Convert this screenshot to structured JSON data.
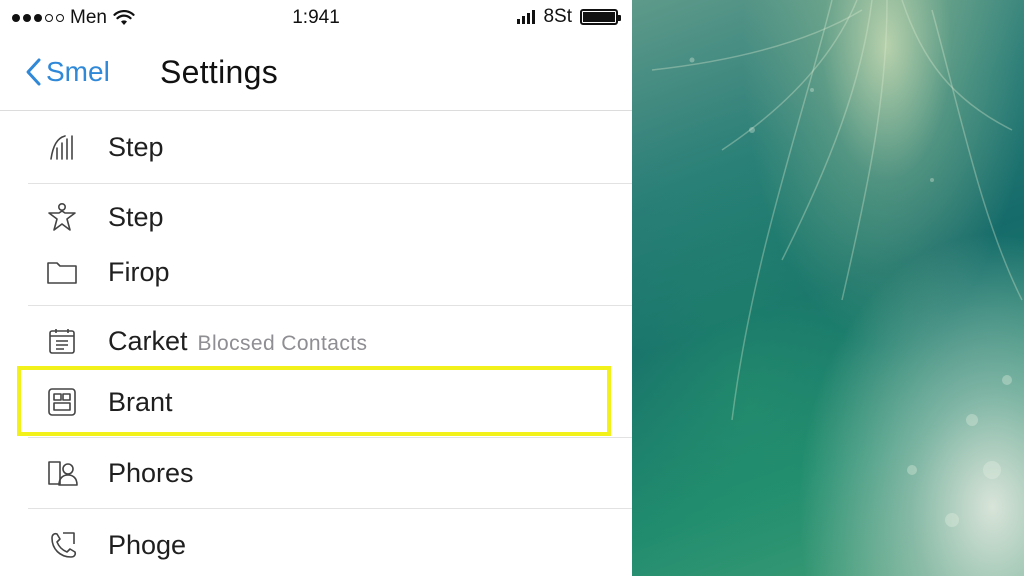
{
  "status_bar": {
    "carrier": "Men",
    "time": "1:941",
    "network": "8St"
  },
  "nav": {
    "back_label": "Smel",
    "title": "Settings"
  },
  "rows": [
    {
      "label": "Step",
      "icon": "chart-bars-icon"
    },
    {
      "label": "Step",
      "icon": "star-person-icon"
    },
    {
      "label": "Firop",
      "icon": "folder-icon"
    },
    {
      "label": "Carket",
      "sublabel": "Blocsed Contacts",
      "icon": "calendar-list-icon"
    },
    {
      "label": "Brant",
      "icon": "grid-card-icon",
      "highlighted": true
    },
    {
      "label": "Phores",
      "icon": "contacts-icon"
    },
    {
      "label": "Phoge",
      "icon": "phone-handset-icon"
    }
  ],
  "colors": {
    "accent": "#2f89d8",
    "highlight": "#f2f21a"
  }
}
